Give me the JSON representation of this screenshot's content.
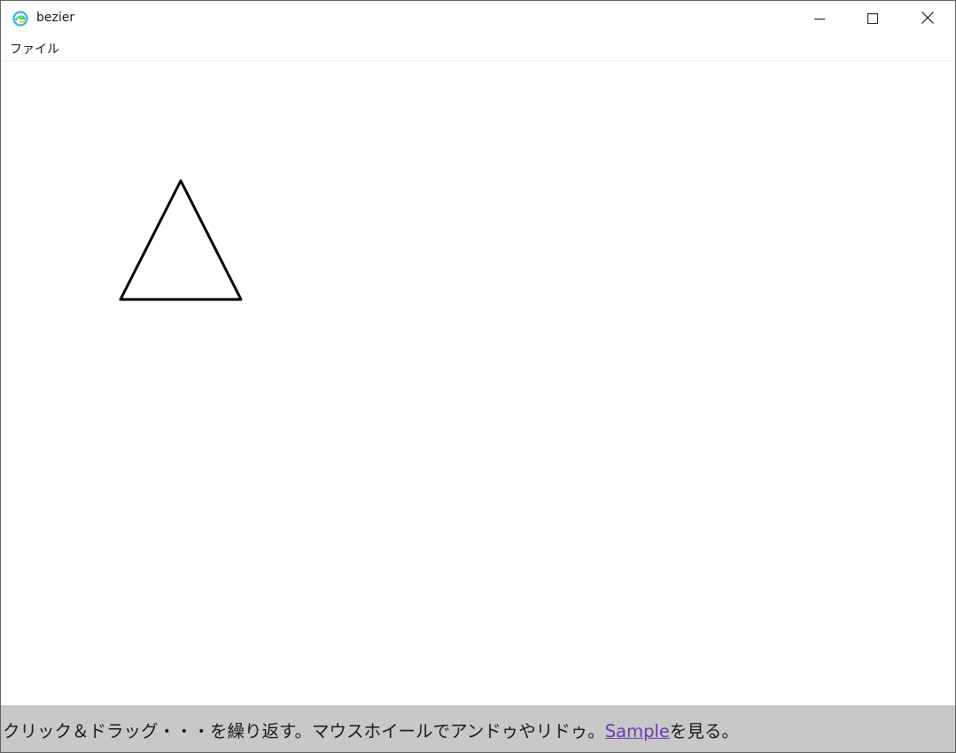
{
  "window": {
    "title": "bezier",
    "app_icon": "edge-browser-icon",
    "controls": {
      "minimize_icon": "minimize-icon",
      "maximize_icon": "maximize-icon",
      "close_icon": "close-icon"
    }
  },
  "menubar": {
    "items": [
      {
        "label": "ファイル"
      }
    ]
  },
  "canvas": {
    "shapes": [
      {
        "type": "triangle",
        "stroke": "#000000"
      }
    ]
  },
  "statusbar": {
    "text_before": "クリック＆ドラッグ・・・を繰り返す。マウスホイールでアンドゥやリドゥ。",
    "link_text": "Sample",
    "text_after": "を見る。",
    "background": "#c8c8c8",
    "link_color": "#6a3ab0"
  }
}
